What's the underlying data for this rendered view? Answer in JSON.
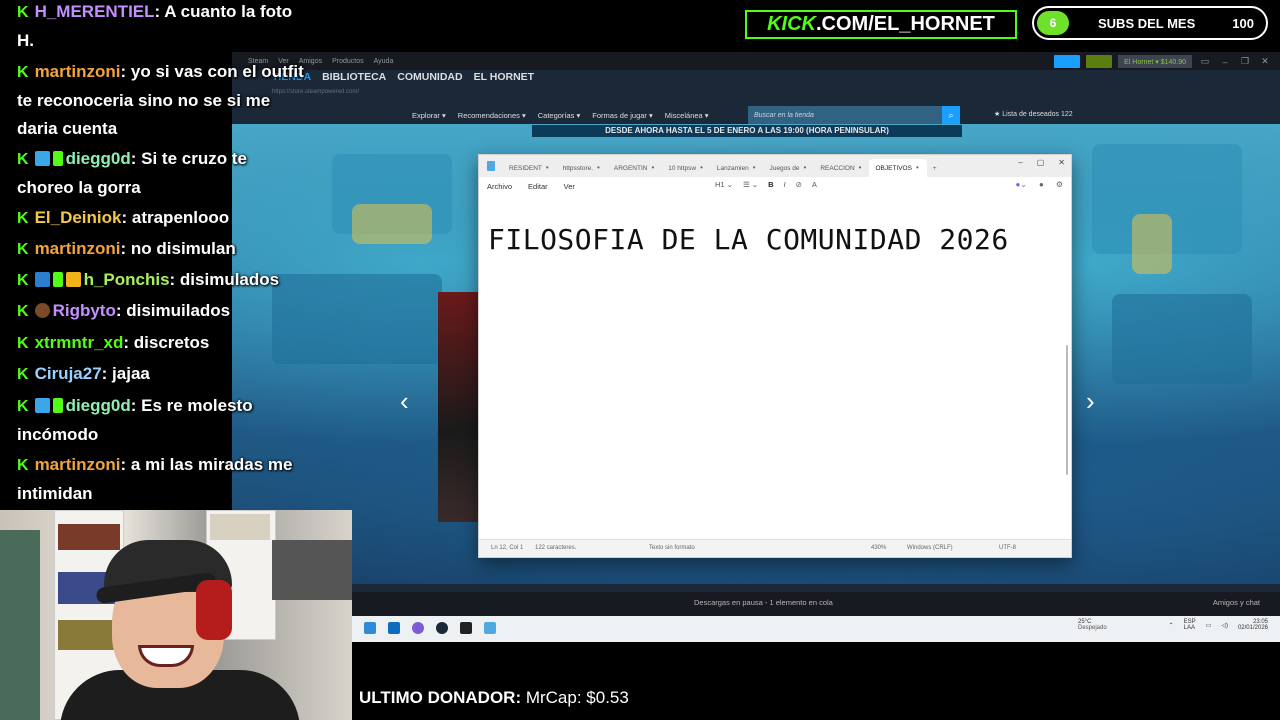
{
  "chat": {
    "messages": [
      {
        "user": "H_MERENTIEL",
        "user_color": "#c390ff",
        "text": ": A cuanto la foto H."
      },
      {
        "user": "martinzoni",
        "user_color": "#f2a33a",
        "text": ": yo si vas con el outfit te reconoceria sino no se si me daria cuenta"
      },
      {
        "user": "diegg0d",
        "user_color": "#8ef0b0",
        "text": ": Si te cruzo te choreo la gorra"
      },
      {
        "user": "El_Deiniok",
        "user_color": "#f2c94c",
        "text": ": atrapenlooo"
      },
      {
        "user": "martinzoni",
        "user_color": "#f2a33a",
        "text": ": no disimulan"
      },
      {
        "user": "h_Ponchis",
        "user_color": "#a8f05c",
        "text": ": disimulados"
      },
      {
        "user": "Rigbyto",
        "user_color": "#c390ff",
        "text": ": disimuilados"
      },
      {
        "user": "xtrmntr_xd",
        "user_color": "#53fc18",
        "text": ": discretos"
      },
      {
        "user": "Ciruja27",
        "user_color": "#9ad0ff",
        "text": ": jajaa"
      },
      {
        "user": "diegg0d",
        "user_color": "#8ef0b0",
        "text": ": Es re molesto incómodo"
      },
      {
        "user": "martinzoni",
        "user_color": "#f2a33a",
        "text": ": a mi las miradas me intimidan"
      }
    ],
    "kick_glyph": "K"
  },
  "overlay": {
    "kick_prefix": "KICK",
    "kick_suffix": ".COM/EL_HORNET",
    "subs_count": "6",
    "subs_label": "SUBS DEL MES",
    "subs_goal": "100",
    "subs_progress": 0.06,
    "donor_label": "ULTIMO DONADOR:",
    "donor_value": " MrCap: $0.53"
  },
  "steam": {
    "menu": [
      "Steam",
      "Ver",
      "Amigos",
      "Productos",
      "Ayuda"
    ],
    "nav": [
      "TIENDA",
      "BIBLIOTECA",
      "COMUNIDAD",
      "EL HORNET"
    ],
    "url": "https://store.steampowered.com/",
    "user_label": "El Hornet ▾ $140.90",
    "subnav": [
      "Explorar ▾",
      "Recomendaciones ▾",
      "Categorías ▾",
      "Formas de jugar ▾",
      "Miscelánea ▾"
    ],
    "search_placeholder": "Buscar en la tienda",
    "wishlist": "★ Lista de deseados 122",
    "promo": "DESDE AHORA HASTA EL 5 DE ENERO A LAS 19:00 (HORA PENINSULAR)",
    "downloads": "Descargas en pausa - 1 elemento en cola",
    "friends": "Amigos y chat",
    "arrow_left": "‹",
    "arrow_right": "›",
    "accent": "#1a9fff"
  },
  "notepad": {
    "tabs": [
      "RESIDENT",
      "httpsstore.",
      "ARGENTIN",
      "10 httpsw",
      "Lanzamien",
      "Juegos de",
      "REACCION",
      "OBJETIVOS"
    ],
    "active_tab": "OBJETIVOS",
    "new_tab": "+",
    "menu": [
      "Archivo",
      "Editar",
      "Ver"
    ],
    "format": [
      "H1 ⌄",
      "☰ ⌄",
      "B",
      "I",
      "⊘",
      "A"
    ],
    "content": "FILOSOFIA DE LA COMUNIDAD 2026",
    "status": {
      "position": "Ln 12, Col 1",
      "chars": "122 caracteres.",
      "format": "Texto sin formato",
      "zoom": "430%",
      "eol": "Windows (CRLF)",
      "encoding": "UTF-8"
    }
  },
  "taskbar": {
    "weather_temp": "25°C",
    "weather_desc": "Despejado",
    "lang_1": "ESP",
    "lang_2": "LAA",
    "time": "23:05",
    "date": "02/01/2026"
  }
}
